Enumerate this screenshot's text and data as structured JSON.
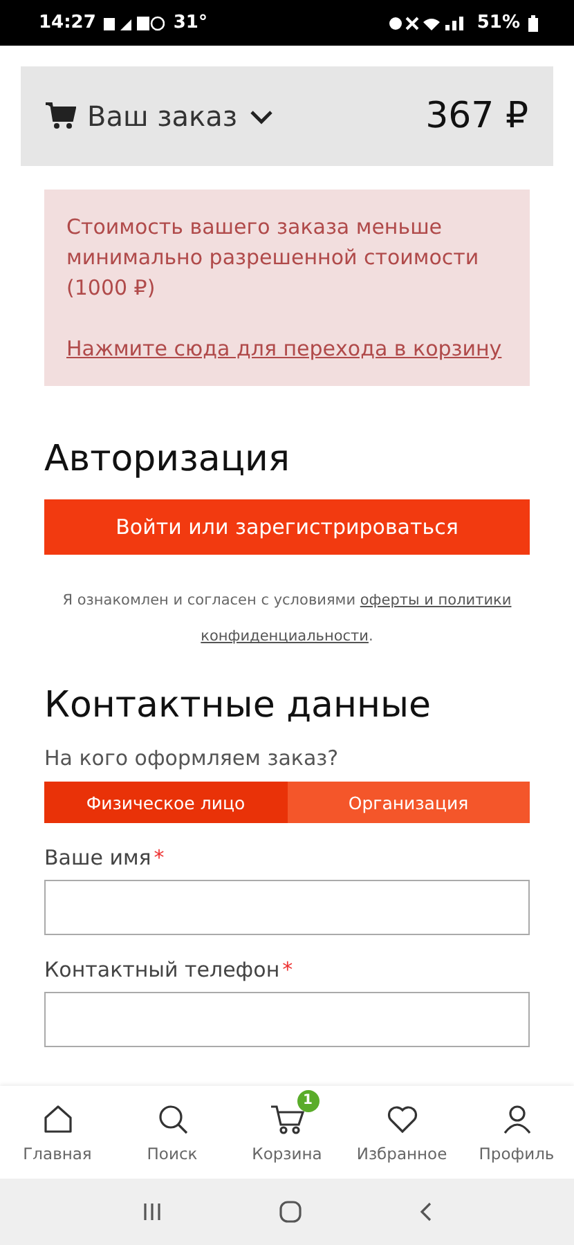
{
  "status_bar": {
    "time": "14:27",
    "temperature": "31°",
    "battery": "51%"
  },
  "order_header": {
    "title": "Ваш заказ",
    "total": "367 ₽",
    "expanded": false
  },
  "alert": {
    "message": "Стоимость вашего заказа меньше минимально разрешенной стоимости (1000 ₽)",
    "link": "Нажмите сюда для перехода в корзину"
  },
  "auth": {
    "heading": "Авторизация",
    "button": "Войти или зарегистрироваться",
    "consent_text": "Я ознакомлен и согласен с условиями ",
    "consent_links": [
      "оферты и политики",
      "конфиденциальности"
    ],
    "consent_end": "."
  },
  "contacts": {
    "heading": "Контактные данные",
    "question": "На кого оформляем заказ?",
    "customer_types": [
      {
        "label": "Физическое лицо",
        "selected": true
      },
      {
        "label": "Организация",
        "selected": false
      }
    ],
    "fields": [
      {
        "label": "Ваше имя",
        "required_mark": "*"
      },
      {
        "label": "Контактный телефон",
        "required_mark": "*"
      }
    ]
  },
  "bottom_nav": [
    {
      "label": "Главная",
      "kind": "home"
    },
    {
      "label": "Поиск",
      "kind": "search"
    },
    {
      "label": "Корзина",
      "kind": "cart",
      "badge": "1"
    },
    {
      "label": "Избранное",
      "kind": "heart"
    },
    {
      "label": "Профиль",
      "kind": "profile"
    }
  ]
}
